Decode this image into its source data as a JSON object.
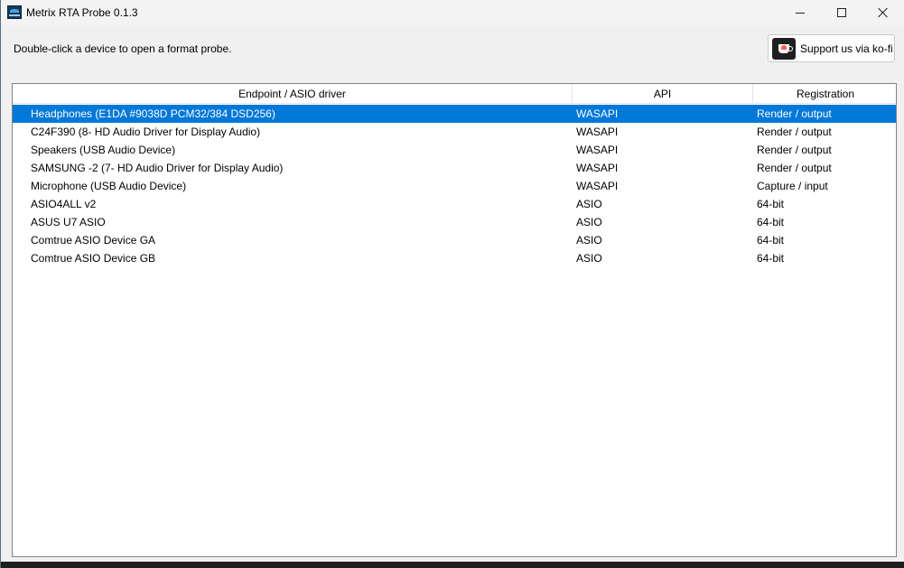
{
  "window": {
    "title": "Metrix RTA Probe 0.1.3",
    "controls": {
      "minimize": "minimize",
      "maximize": "maximize",
      "close": "close"
    }
  },
  "hint": "Double-click a device to open a format probe.",
  "kofi": {
    "label": "Support us via ko-fi",
    "icon": "kofi-cup-icon"
  },
  "table": {
    "columns": [
      "Endpoint / ASIO driver",
      "API",
      "Registration"
    ],
    "rows": [
      {
        "endpoint": "Headphones (E1DA #9038D PCM32/384 DSD256)",
        "api": "WASAPI",
        "registration": "Render / output",
        "selected": true
      },
      {
        "endpoint": "C24F390 (8- HD Audio Driver for Display Audio)",
        "api": "WASAPI",
        "registration": "Render / output"
      },
      {
        "endpoint": "Speakers (USB Audio Device)",
        "api": "WASAPI",
        "registration": "Render / output"
      },
      {
        "endpoint": "SAMSUNG -2 (7- HD Audio Driver for Display Audio)",
        "api": "WASAPI",
        "registration": "Render / output"
      },
      {
        "endpoint": "Microphone (USB Audio Device)",
        "api": "WASAPI",
        "registration": "Capture / input"
      },
      {
        "endpoint": "ASIO4ALL v2",
        "api": "ASIO",
        "registration": "64-bit"
      },
      {
        "endpoint": "ASUS U7 ASIO",
        "api": "ASIO",
        "registration": "64-bit"
      },
      {
        "endpoint": "Comtrue ASIO Device GA",
        "api": "ASIO",
        "registration": "64-bit"
      },
      {
        "endpoint": "Comtrue ASIO Device GB",
        "api": "ASIO",
        "registration": "64-bit"
      }
    ]
  },
  "colors": {
    "selection": "#0078d7",
    "window_bg": "#f0f0f0",
    "list_bg": "#ffffff"
  }
}
